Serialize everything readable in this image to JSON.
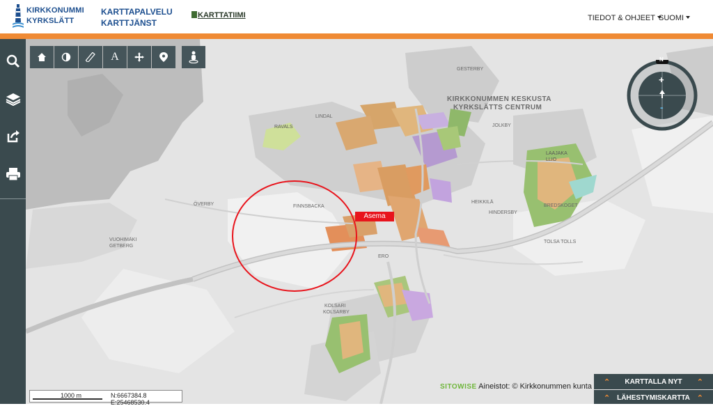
{
  "header": {
    "logo_line1": "KIRKKONUMMI",
    "logo_line2": "KYRKSLÄTT",
    "service_line1": "KARTTAPALVELU",
    "service_line2": "KARTTJÄNST",
    "karttatiimi": "KARTTATIIMI",
    "nav_info": "TIEDOT & OHJEET",
    "nav_lang": "SUOMI"
  },
  "sidebar": {
    "items": [
      {
        "icon": "search-icon"
      },
      {
        "icon": "layers-icon"
      },
      {
        "icon": "share-icon"
      },
      {
        "icon": "print-icon"
      }
    ]
  },
  "toolbar": {
    "tools": [
      "home-icon",
      "contrast-icon",
      "measure-icon",
      "text-icon",
      "pan-icon",
      "marker-icon",
      "streetview-icon"
    ],
    "text_tool": "A"
  },
  "compass": {
    "north": "N",
    "zoom_in": "+",
    "zoom_out": "-"
  },
  "map": {
    "place_labels": [
      {
        "text": "KIRKKONUMMEN KESKUSTA"
      },
      {
        "text": "KYRKSLÄTTS CENTRUM"
      },
      {
        "text": "GESTERBY"
      },
      {
        "text": "JOLKBY"
      },
      {
        "text": "LINDAL"
      },
      {
        "text": "RAVALS"
      },
      {
        "text": "LAAJAKALLIO"
      },
      {
        "text": "HEIKKILÄ"
      },
      {
        "text": "HINDERSBY"
      },
      {
        "text": "BREDSKOGET"
      },
      {
        "text": "FINNSBACKA"
      },
      {
        "text": "ÖVERBY"
      },
      {
        "text": "VUOHIMÄKI"
      },
      {
        "text": "GETBERG"
      },
      {
        "text": "TOLSA TOLLS"
      },
      {
        "text": "KOLSARI"
      },
      {
        "text": "KOLSARBY"
      },
      {
        "text": "ERO"
      }
    ],
    "marker_label": "Asema",
    "highlight_circle": true
  },
  "scale": {
    "length": "1000 m",
    "coords": "N:6667384.8 E:25468530.4"
  },
  "credit": {
    "brand": "SITOWISE",
    "text": "Aineistot: © Kirkkonummen kunta"
  },
  "panels": {
    "map_now": "KARTTALLA NYT",
    "nearby": "LÄHESTYMISKARTTA"
  },
  "colors": {
    "accent": "#ef8a34",
    "sidebar": "#3a4a4e",
    "marker": "#e8141c",
    "circle": "#e8141c"
  }
}
